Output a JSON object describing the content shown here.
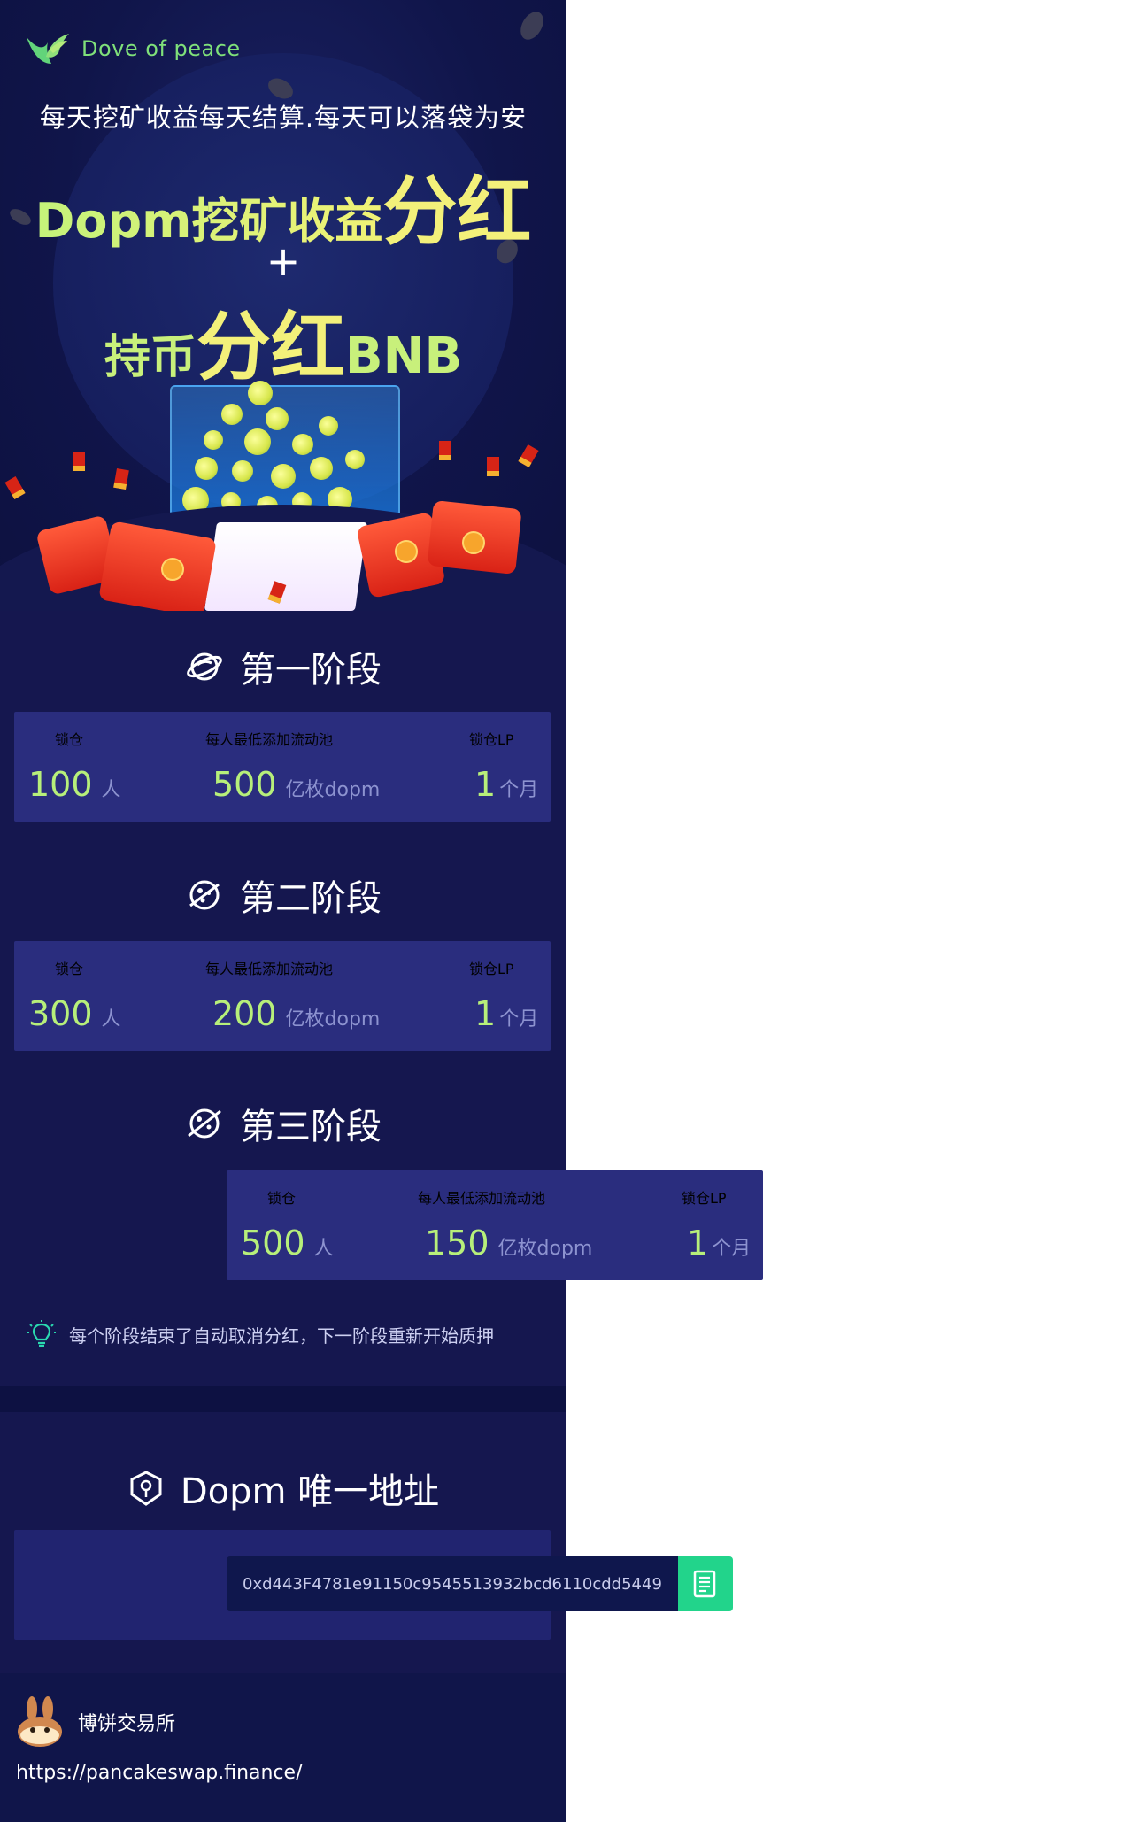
{
  "brand": {
    "name": "Dove of peace"
  },
  "hero": {
    "subtitle": "每天挖矿收益每天结算.每天可以落袋为安",
    "line1_a": "Dopm挖矿收益",
    "line1_b": "分红",
    "plus": "+",
    "line2_a": "持币",
    "line2_b": "分红",
    "line2_c": "BNB"
  },
  "stages": [
    {
      "title": "第一阶段",
      "lock_label": "锁仓",
      "lock_value": "100",
      "lock_unit": "人",
      "pool_label": "每人最低添加流动池",
      "pool_value": "500",
      "pool_unit": "亿枚dopm",
      "lp_label": "锁仓LP",
      "lp_value": "1",
      "lp_unit": "个月"
    },
    {
      "title": "第二阶段",
      "lock_label": "锁仓",
      "lock_value": "300",
      "lock_unit": "人",
      "pool_label": "每人最低添加流动池",
      "pool_value": "200",
      "pool_unit": "亿枚dopm",
      "lp_label": "锁仓LP",
      "lp_value": "1",
      "lp_unit": "个月"
    },
    {
      "title": "第三阶段",
      "lock_label": "锁仓",
      "lock_value": "500",
      "lock_unit": "人",
      "pool_label": "每人最低添加流动池",
      "pool_value": "150",
      "pool_unit": "亿枚dopm",
      "lp_label": "锁仓LP",
      "lp_value": "1",
      "lp_unit": "个月"
    }
  ],
  "tip": "每个阶段结束了自动取消分红，下一阶段重新开始质押",
  "address": {
    "title": "Dopm 唯一地址",
    "value": "0xd443F4781e91150c9545513932bcd6110cdd5449"
  },
  "footer": {
    "exchange_name": "博饼交易所",
    "link": "https://pancakeswap.finance/"
  },
  "colors": {
    "background": "#15174f",
    "accent_green": "#b7ef7a",
    "accent_yellow": "#f3f07a",
    "copy_button": "#22d48b"
  },
  "icons": {
    "brand": "dove-wing-icon",
    "stage1": "planet-icon",
    "stage2": "planet-dots-icon",
    "stage3": "planet-ring-icon",
    "tip": "lightbulb-icon",
    "address": "shield-icon",
    "copy": "copy-icon",
    "exchange": "pancake-bunny-icon"
  }
}
